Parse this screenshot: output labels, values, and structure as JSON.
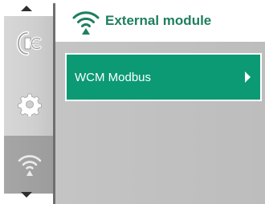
{
  "header": {
    "title": "External module",
    "icon": "wireless-signal-icon",
    "accent_color": "#1f7f5e"
  },
  "sidebar": {
    "items": [
      {
        "icon": "pump-settings-icon",
        "selected": false
      },
      {
        "icon": "gear-icon",
        "selected": false
      },
      {
        "icon": "wireless-signal-icon",
        "selected": true
      }
    ]
  },
  "menu": {
    "items": [
      {
        "label": "WCM Modbus",
        "icon": "chevron-right-icon",
        "color": "#0b9a73"
      }
    ]
  }
}
